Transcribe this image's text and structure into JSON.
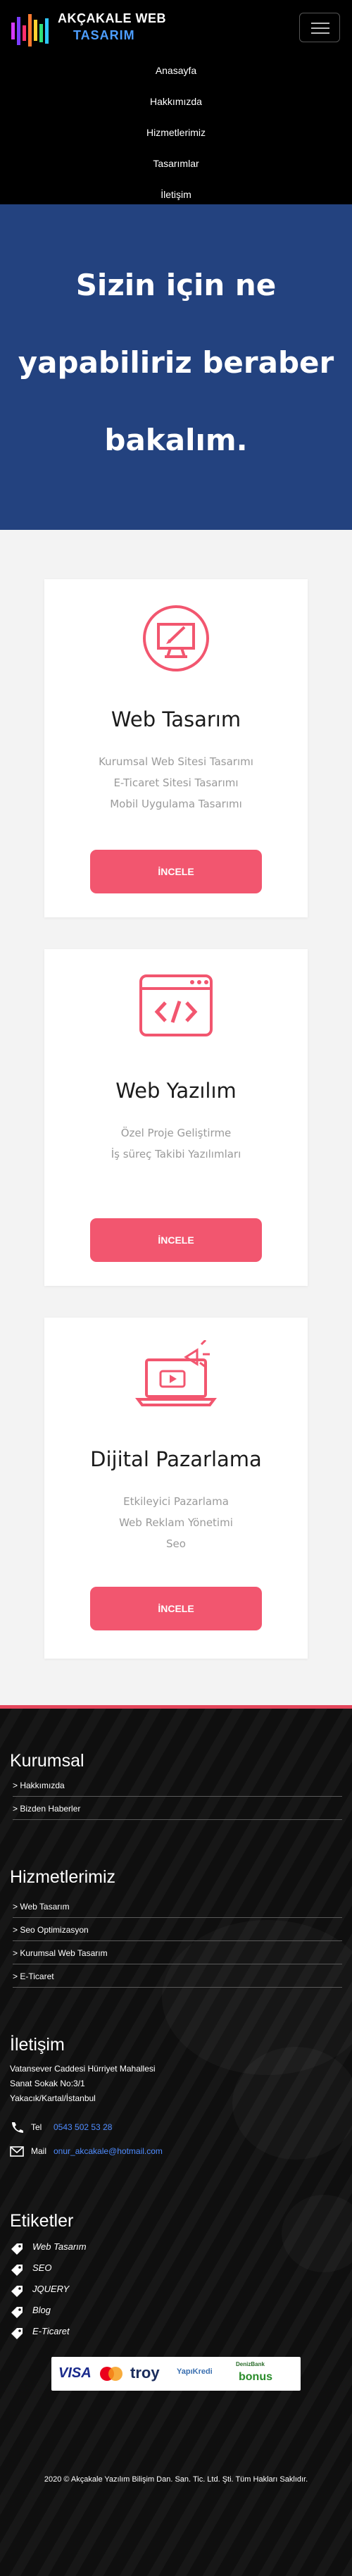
{
  "brand": {
    "line1": "AKÇAKALE WEB",
    "line2": "TASARIM"
  },
  "nav": [
    "Anasayfa",
    "Hakkımızda",
    "Hizmetlerimiz",
    "Tasarımlar",
    "İletişim"
  ],
  "hero": {
    "lines": [
      "Sizin için ne",
      "yapabiliriz beraber",
      "bakalım."
    ]
  },
  "services": [
    {
      "title": "Web Tasarım",
      "items": [
        "Kurumsal Web Sitesi Tasarımı",
        "E-Ticaret Sitesi Tasarımı",
        "Mobil Uygulama Tasarımı"
      ],
      "button": "İNCELE",
      "icon": "monitor-pen-icon"
    },
    {
      "title": "Web Yazılım",
      "items": [
        "Özel Proje Geliştirme",
        "İş süreç Takibi Yazılımları"
      ],
      "button": "İNCELE",
      "icon": "code-window-icon"
    },
    {
      "title": "Dijital Pazarlama",
      "items": [
        "Etkileyici Pazarlama",
        "Web Reklam Yönetimi",
        "Seo"
      ],
      "button": "İNCELE",
      "icon": "megaphone-laptop-icon"
    }
  ],
  "footer": {
    "kurumsal": {
      "title": "Kurumsal",
      "links": [
        "> Hakkımızda",
        "> Bizden Haberler"
      ]
    },
    "hizmetler": {
      "title": "Hizmetlerimiz",
      "links": [
        "> Web Tasarım",
        "> Seo Optimizasyon",
        "> Kurumsal Web Tasarım",
        "> E-Ticaret"
      ]
    },
    "iletisim": {
      "title": "İletişim",
      "address": [
        "Vatansever Caddesi Hürriyet Mahallesi",
        "Sanat Sokak No:3/1",
        "Yakacık/Kartal/İstanbul"
      ],
      "tel_label": "Tel",
      "tel": "0543 502 53 28",
      "mail_label": "Mail",
      "mail": "onur_akcakale@hotmail.com"
    },
    "etiketler": {
      "title": "Etiketler",
      "tags": [
        "Web Tasarım",
        "SEO",
        "JQUERY",
        "Blog",
        "E-Ticaret"
      ]
    },
    "payments": {
      "visa": "VISA",
      "troy": "troy",
      "yapikredi": "YapıKredi",
      "denizbank": "DenizBank",
      "bonus": "bonus"
    },
    "copyright": "2020 © Akçakale Yazılım Bilişim Dan. San. Tic. Ltd. Şti. Tüm Hakları Saklıdır."
  },
  "colors": {
    "accent": "#f2566f",
    "hero_bg": "#23427f",
    "link_blue": "#4f8cff"
  }
}
